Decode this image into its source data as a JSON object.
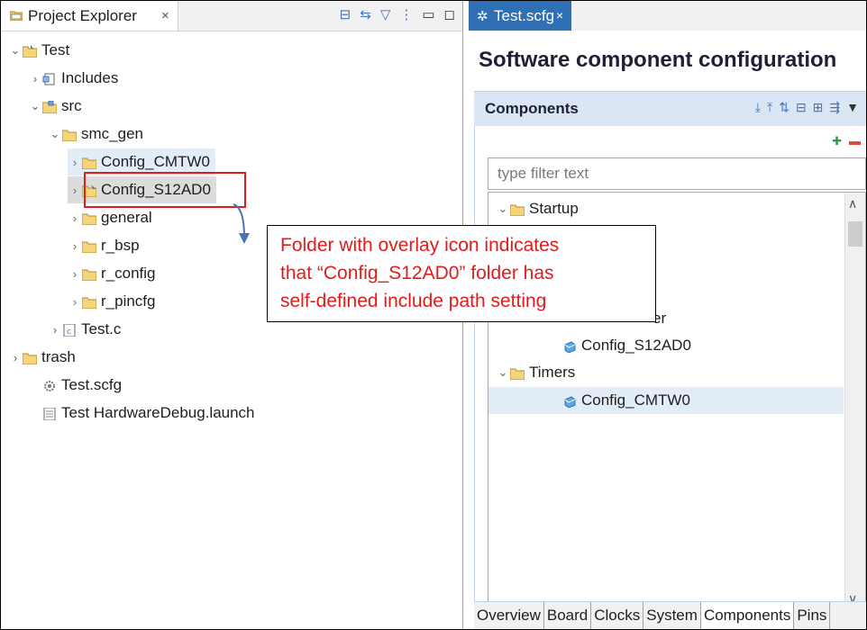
{
  "left": {
    "tab_label": "Project Explorer",
    "tab_close": "×",
    "tree": [
      {
        "label": "Test",
        "twisty": "⌄",
        "icon": "project-folder-icon"
      },
      {
        "label": "Includes",
        "twisty": "›",
        "icon": "includes-icon"
      },
      {
        "label": "src",
        "twisty": "⌄",
        "icon": "source-folder-icon"
      },
      {
        "label": "smc_gen",
        "twisty": "⌄",
        "icon": "folder-icon"
      },
      {
        "label": "Config_CMTW0",
        "twisty": "›",
        "icon": "folder-icon"
      },
      {
        "label": "Config_S12AD0",
        "twisty": "›",
        "icon": "folder-overlay-icon"
      },
      {
        "label": "general",
        "twisty": "›",
        "icon": "folder-icon"
      },
      {
        "label": "r_bsp",
        "twisty": "›",
        "icon": "folder-icon"
      },
      {
        "label": "r_config",
        "twisty": "›",
        "icon": "folder-icon"
      },
      {
        "label": "r_pincfg",
        "twisty": "›",
        "icon": "folder-icon"
      },
      {
        "label": "Test.c",
        "twisty": "›",
        "icon": "c-file-icon"
      },
      {
        "label": "trash",
        "twisty": "›",
        "icon": "folder-icon"
      },
      {
        "label": "Test.scfg",
        "twisty": "",
        "icon": "gear-file-icon"
      },
      {
        "label": "Test HardwareDebug.launch",
        "twisty": "",
        "icon": "launch-file-icon"
      }
    ]
  },
  "callout": {
    "lines": [
      "Folder with overlay icon indicates",
      "that “Config_S12AD0” folder has",
      "self-defined include path setting"
    ]
  },
  "right": {
    "tab_label": "Test.scfg",
    "tab_close": "×",
    "title": "Software component configuration",
    "components_title": "Components",
    "filter_placeholder": "type filter text",
    "tree": [
      {
        "label": "Startup",
        "twisty": "⌄",
        "icon": "folder-icon"
      },
      {
        "label": "er",
        "twisty": "",
        "icon": ""
      },
      {
        "label": "Config_S12AD0",
        "twisty": "",
        "icon": "component-icon"
      },
      {
        "label": "Timers",
        "twisty": "⌄",
        "icon": "folder-icon"
      },
      {
        "label": "Config_CMTW0",
        "twisty": "",
        "icon": "component-icon"
      }
    ],
    "bottom_tabs": [
      "Overview",
      "Board",
      "Clocks",
      "System",
      "Components",
      "Pins"
    ],
    "active_bottom_tab": "Components"
  }
}
